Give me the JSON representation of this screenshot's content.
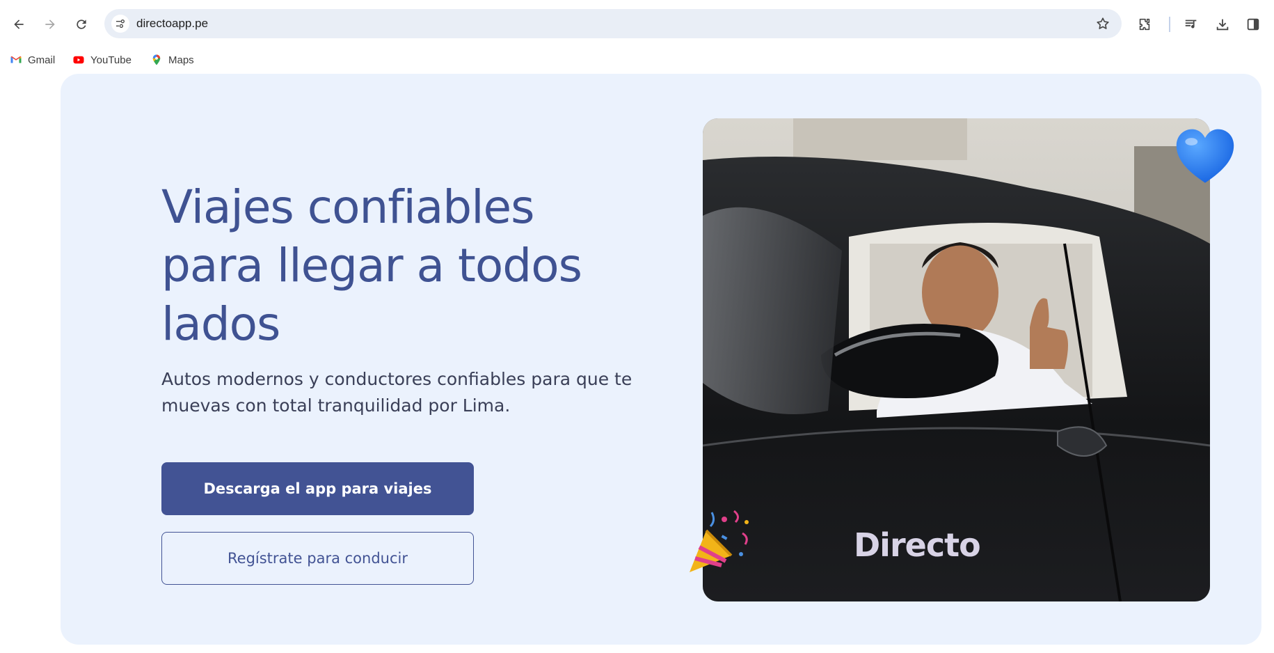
{
  "browser": {
    "url": "directoapp.pe",
    "bookmarks": [
      {
        "label": "Gmail",
        "icon": "gmail-icon"
      },
      {
        "label": "YouTube",
        "icon": "youtube-icon"
      },
      {
        "label": "Maps",
        "icon": "maps-icon"
      }
    ]
  },
  "hero": {
    "headline": "Viajes confiables para llegar a todos lados",
    "subhead": "Autos modernos y conductores confiables para que te muevas con total tranquilidad por Lima.",
    "primary_button": "Descarga el app para viajes",
    "secondary_button": "Regístrate para conducir",
    "car_brand": "Directo"
  },
  "colors": {
    "accent": "#425394",
    "hero_bg": "#ebf2fd",
    "headline": "#3f5292"
  }
}
